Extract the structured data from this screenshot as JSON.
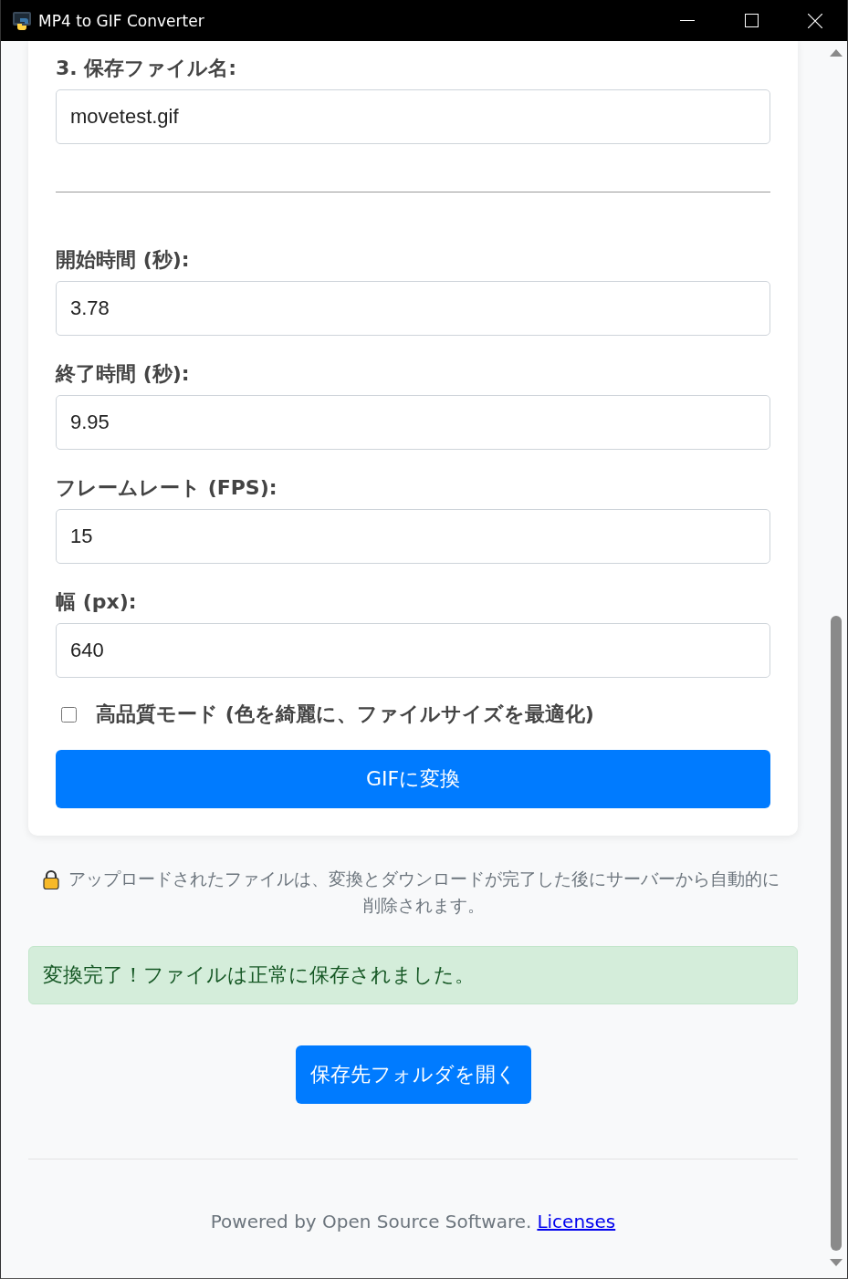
{
  "window": {
    "title": "MP4 to GIF Converter"
  },
  "form": {
    "filename_field": {
      "label": "3. 保存ファイル名:",
      "value": "movetest.gif"
    },
    "fields": [
      {
        "label": "開始時間 (秒):",
        "value": "3.78"
      },
      {
        "label": "終了時間 (秒):",
        "value": "9.95"
      },
      {
        "label": "フレームレート (FPS):",
        "value": "15"
      },
      {
        "label": "幅 (px):",
        "value": "640"
      }
    ],
    "high_quality": {
      "label": "高品質モード (色を綺麗に、ファイルサイズを最適化)",
      "checked": false
    },
    "convert_button": "GIFに変換"
  },
  "notice": {
    "text": "アップロードされたファイルは、変換とダウンロードが完了した後にサーバーから自動的に削除されます。"
  },
  "alert": {
    "kind": "success",
    "text": "変換完了！ファイルは正常に保存されました。"
  },
  "open_folder_button": "保存先フォルダを開く",
  "footer": {
    "text": "Powered by Open Source Software.",
    "link": "Licenses"
  }
}
